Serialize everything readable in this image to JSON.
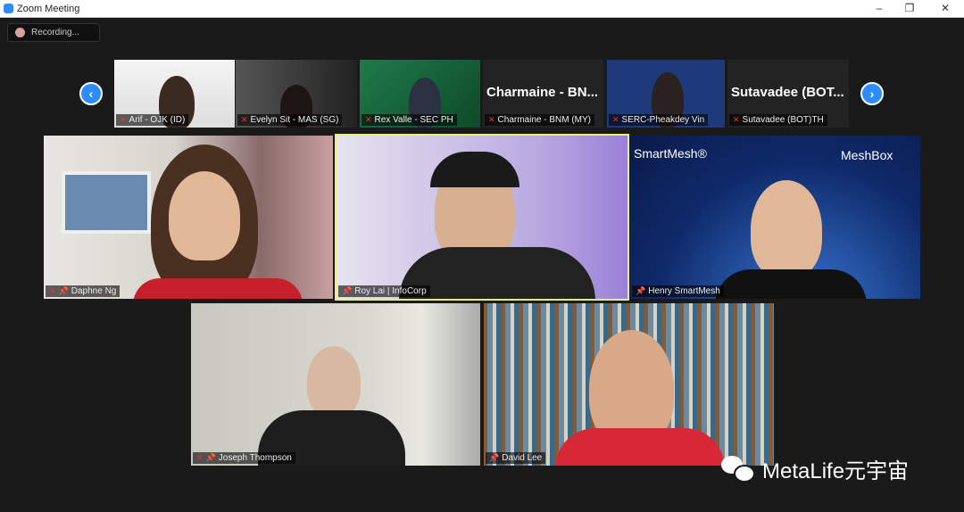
{
  "window": {
    "title": "Zoom Meeting",
    "minimize": "–",
    "restore": "❐",
    "close": "✕"
  },
  "recording": {
    "label": "Recording..."
  },
  "strip": {
    "prev": "‹",
    "next": "›",
    "thumbnails": [
      {
        "name": "Arif - OJK (ID)",
        "muted": true
      },
      {
        "name": "Evelyn Sit - MAS (SG)",
        "muted": true
      },
      {
        "name": "Rex Valle - SEC PH",
        "muted": true
      },
      {
        "name": "Charmaine - BNM (MY)",
        "muted": true,
        "display": "Charmaine  -  BN..."
      },
      {
        "name": "SERC-Pheakdey Vin",
        "muted": true
      },
      {
        "name": "Sutavadee (BOT)TH",
        "muted": true,
        "display": "Sutavadee  (BOT..."
      }
    ]
  },
  "gallery": [
    {
      "name": "Daphne Ng",
      "muted": true,
      "pinned": true
    },
    {
      "name": "Roy Lai | InfoCorp",
      "muted": false,
      "pinned": true,
      "active_speaker": true
    },
    {
      "name": "Henry SmartMesh",
      "muted": false,
      "pinned": true,
      "logos": [
        "SmartMesh®",
        "MeshBox"
      ]
    },
    {
      "name": "Joseph Thompson",
      "muted": true,
      "pinned": true
    },
    {
      "name": "David Lee",
      "muted": false,
      "pinned": true
    }
  ],
  "watermark": "MetaLife元宇宙",
  "colors": {
    "accent": "#2d8cff",
    "active_border": "#e8ef7a",
    "muted": "#e33333"
  }
}
